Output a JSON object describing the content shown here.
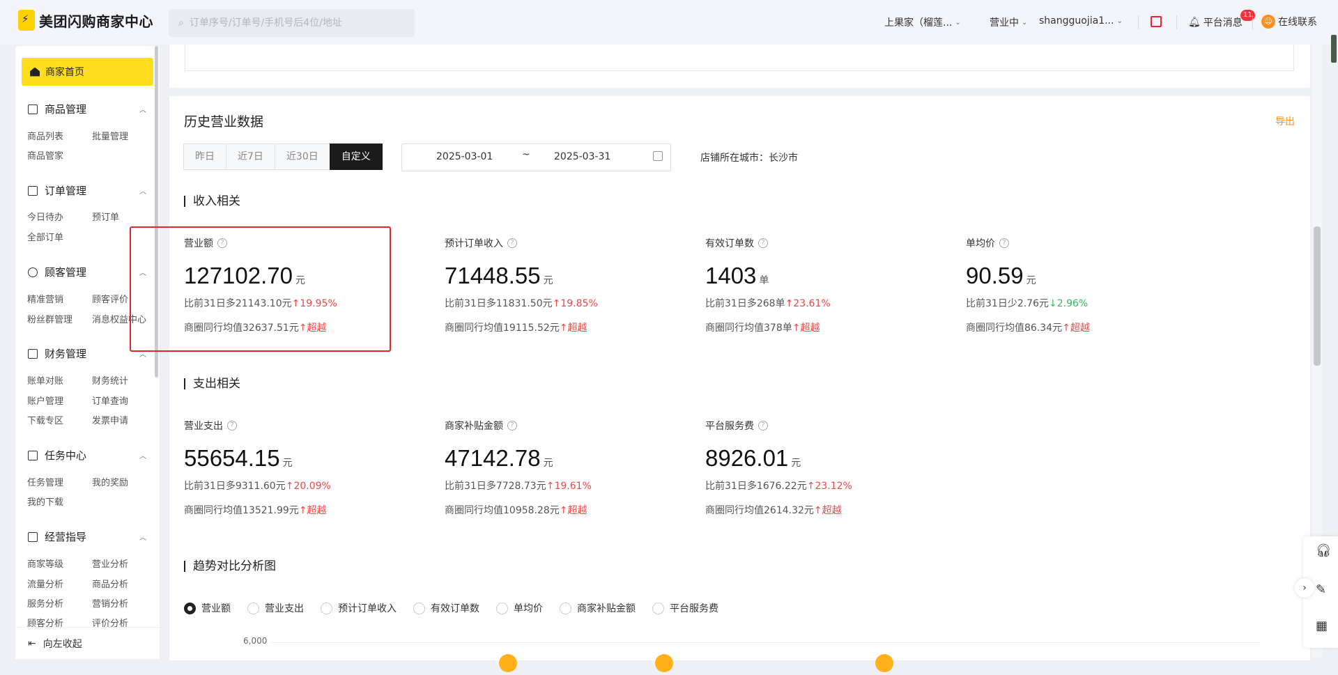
{
  "header": {
    "logo_text": "美团闪购商家中心",
    "search_placeholder": "订单序号/订单号/手机号后4位/地址",
    "store_name": "上果家（榴莲...",
    "business_status": "营业中",
    "account": "shangguojia1...",
    "messages_label": "平台消息",
    "messages_badge": "11",
    "online_service": "在线联系"
  },
  "sidebar": {
    "home": "商家首页",
    "sections": [
      {
        "title": "商品管理",
        "items": [
          "商品列表",
          "批量管理",
          "商品管家"
        ]
      },
      {
        "title": "订单管理",
        "items": [
          "今日待办",
          "预订单",
          "全部订单"
        ]
      },
      {
        "title": "顾客管理",
        "items": [
          "精准营销",
          "顾客评价",
          "粉丝群管理",
          "消息权益中心"
        ]
      },
      {
        "title": "财务管理",
        "items": [
          "账单对账",
          "财务统计",
          "账户管理",
          "订单查询",
          "下载专区",
          "发票申请"
        ]
      },
      {
        "title": "任务中心",
        "items": [
          "任务管理",
          "我的奖励",
          "我的下载"
        ]
      },
      {
        "title": "经营指导",
        "items": [
          "商家等级",
          "营业分析",
          "流量分析",
          "商品分析",
          "服务分析",
          "营销分析",
          "顾客分析",
          "评价分析"
        ]
      }
    ],
    "collapse": "向左收起"
  },
  "main": {
    "title": "历史营业数据",
    "export": "导出",
    "range_tabs": [
      "昨日",
      "近7日",
      "近30日",
      "自定义"
    ],
    "date_start": "2025-03-01",
    "date_sep": "~",
    "date_end": "2025-03-31",
    "city": "店铺所在城市：长沙市",
    "income_title": "收入相关",
    "expense_title": "支出相关",
    "trend_title": "趋势对比分析图",
    "income": [
      {
        "label": "营业额",
        "value": "127102.70",
        "unit": "元",
        "compare": "比前31日多21143.10元",
        "change": "19.95%",
        "dir": "up",
        "peer": "商圈同行均值32637.51元",
        "peer_tag": "超越"
      },
      {
        "label": "预计订单收入",
        "value": "71448.55",
        "unit": "元",
        "compare": "比前31日多11831.50元",
        "change": "19.85%",
        "dir": "up",
        "peer": "商圈同行均值19115.52元",
        "peer_tag": "超越"
      },
      {
        "label": "有效订单数",
        "value": "1403",
        "unit": "单",
        "compare": "比前31日多268单",
        "change": "23.61%",
        "dir": "up",
        "peer": "商圈同行均值378单",
        "peer_tag": "超越"
      },
      {
        "label": "单均价",
        "value": "90.59",
        "unit": "元",
        "compare": "比前31日少2.76元",
        "change": "2.96%",
        "dir": "down",
        "peer": "商圈同行均值86.34元",
        "peer_tag": "超越"
      }
    ],
    "expense": [
      {
        "label": "营业支出",
        "value": "55654.15",
        "unit": "元",
        "compare": "比前31日多9311.60元",
        "change": "20.09%",
        "dir": "up",
        "peer": "商圈同行均值13521.99元",
        "peer_tag": "超越"
      },
      {
        "label": "商家补贴金额",
        "value": "47142.78",
        "unit": "元",
        "compare": "比前31日多7728.73元",
        "change": "19.61%",
        "dir": "up",
        "peer": "商圈同行均值10958.28元",
        "peer_tag": "超越"
      },
      {
        "label": "平台服务费",
        "value": "8926.01",
        "unit": "元",
        "compare": "比前31日多1676.22元",
        "change": "23.12%",
        "dir": "up",
        "peer": "商圈同行均值2614.32元",
        "peer_tag": "超越"
      }
    ],
    "trend_options": [
      "营业额",
      "营业支出",
      "预计订单收入",
      "有效订单数",
      "单均价",
      "商家补贴金额",
      "平台服务费"
    ],
    "y_tick": "6,000"
  },
  "colors": {
    "accent_yellow": "#ffdd1f",
    "up": "#f04646",
    "down": "#2fbe5a",
    "export": "#ff8f1f",
    "highlight_box": "#e8262a"
  }
}
